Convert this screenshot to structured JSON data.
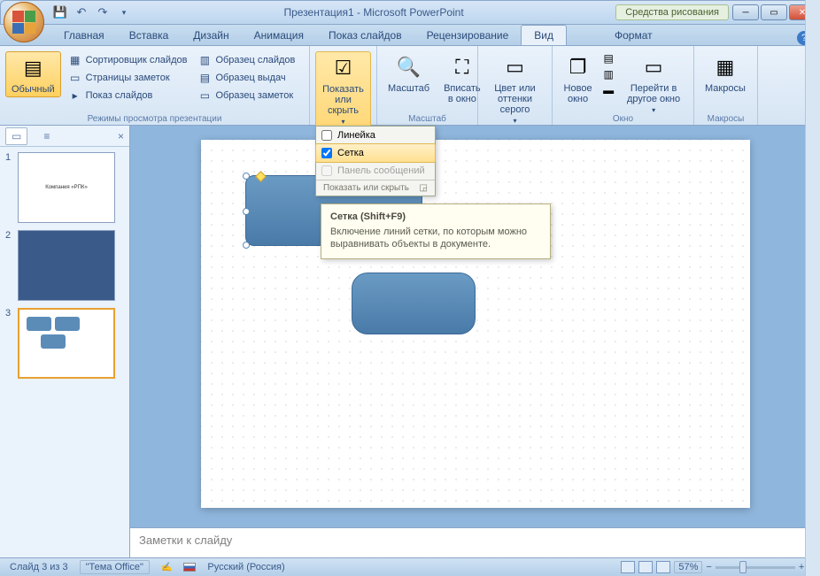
{
  "title": "Презентация1 - Microsoft PowerPoint",
  "tool_context": "Средства рисования",
  "tabs": {
    "home": "Главная",
    "insert": "Вставка",
    "design": "Дизайн",
    "anim": "Анимация",
    "slideshow": "Показ слайдов",
    "review": "Рецензирование",
    "view": "Вид",
    "format": "Формат"
  },
  "ribbon": {
    "normal": "Обычный",
    "sorter": "Сортировщик слайдов",
    "notes_page": "Страницы заметок",
    "show": "Показ слайдов",
    "master_slides": "Образец слайдов",
    "master_handout": "Образец выдач",
    "master_notes": "Образец заметок",
    "group_views": "Режимы просмотра презентации",
    "show_hide": "Показать или скрыть",
    "zoom": "Масштаб",
    "fit": "Вписать в окно",
    "group_zoom": "Масштаб",
    "color": "Цвет или оттенки серого",
    "new_window": "Новое окно",
    "switch": "Перейти в другое окно",
    "group_window": "Окно",
    "macros": "Макросы",
    "group_macros": "Макросы"
  },
  "dropdown": {
    "ruler": "Линейка",
    "grid": "Сетка",
    "msgbar": "Панель сообщений",
    "footer": "Показать или скрыть"
  },
  "tooltip": {
    "title": "Сетка (Shift+F9)",
    "body": "Включение линий сетки, по которым можно выравнивать объекты в документе."
  },
  "notes_placeholder": "Заметки к слайду",
  "status": {
    "slide": "Слайд 3 из 3",
    "theme": "\"Тема Office\"",
    "lang": "Русский (Россия)",
    "zoom": "57%"
  },
  "thumbs": {
    "t1_text": "Компания «РПК»"
  }
}
